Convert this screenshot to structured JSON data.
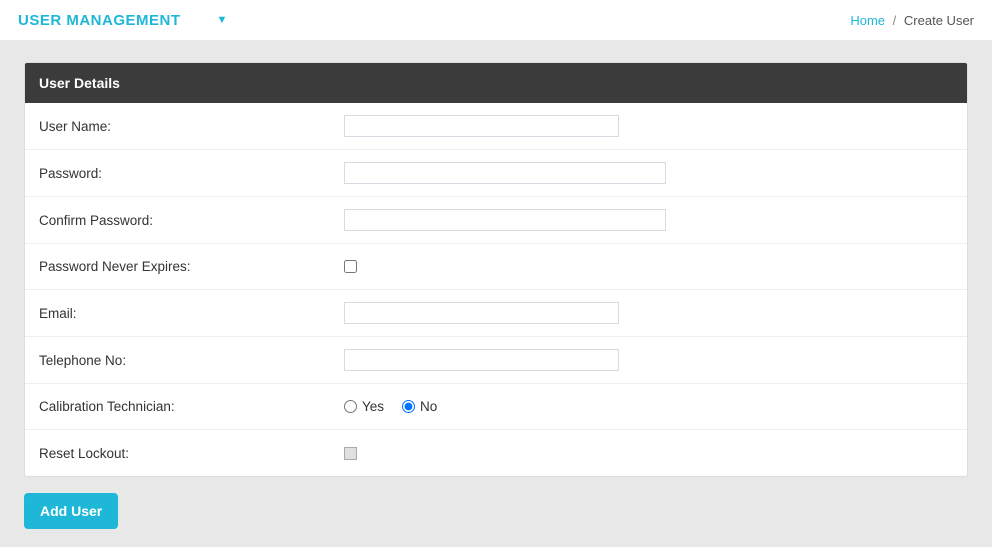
{
  "header": {
    "title": "USER MANAGEMENT"
  },
  "breadcrumb": {
    "home": "Home",
    "current": "Create User"
  },
  "panel": {
    "title": "User Details"
  },
  "form": {
    "username": {
      "label": "User Name:",
      "value": ""
    },
    "password": {
      "label": "Password:",
      "value": ""
    },
    "confirm_password": {
      "label": "Confirm Password:",
      "value": ""
    },
    "password_never_expires": {
      "label": "Password Never Expires:",
      "checked": false
    },
    "email": {
      "label": "Email:",
      "value": ""
    },
    "telephone": {
      "label": "Telephone No:",
      "value": ""
    },
    "calibration_technician": {
      "label": "Calibration Technician:",
      "options": {
        "yes": "Yes",
        "no": "No"
      },
      "value": "no"
    },
    "reset_lockout": {
      "label": "Reset Lockout:",
      "checked": false,
      "disabled": true
    }
  },
  "actions": {
    "add_user": "Add User"
  }
}
